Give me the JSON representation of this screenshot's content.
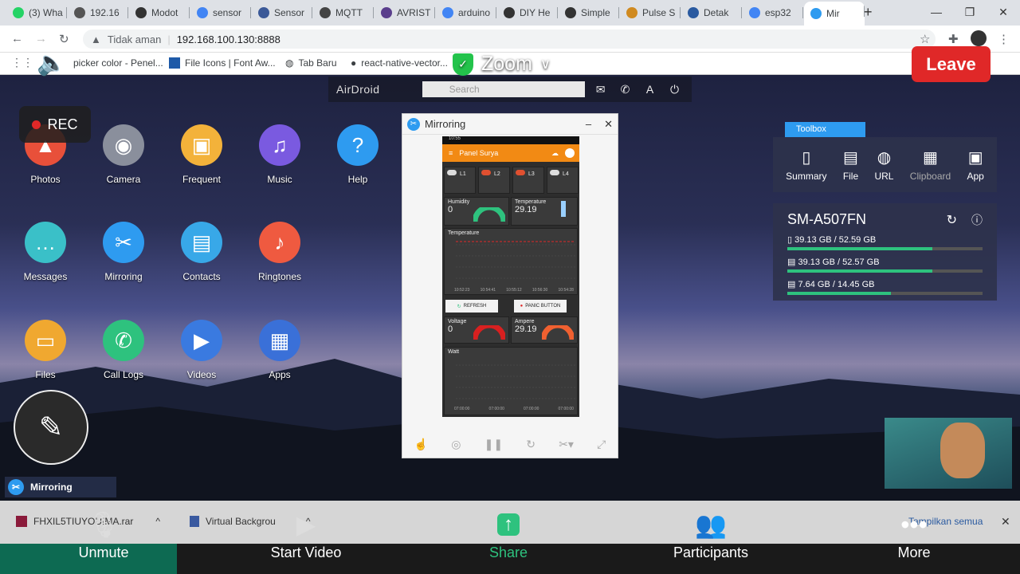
{
  "browser": {
    "tabs": [
      {
        "label": "(3) Wha",
        "color": "#25d366"
      },
      {
        "label": "192.16",
        "color": "#555"
      },
      {
        "label": "Modot",
        "color": "#333"
      },
      {
        "label": "sensor",
        "color": "#4285f4"
      },
      {
        "label": "Sensor",
        "color": "#3b5998"
      },
      {
        "label": "MQTT",
        "color": "#444"
      },
      {
        "label": "AVRIST",
        "color": "#5a3e8c"
      },
      {
        "label": "arduino",
        "color": "#4285f4"
      },
      {
        "label": "DIY He",
        "color": "#333"
      },
      {
        "label": "Simple",
        "color": "#333"
      },
      {
        "label": "Pulse S",
        "color": "#d08a20"
      },
      {
        "label": "Detak",
        "color": "#2a5aa0"
      },
      {
        "label": "esp32",
        "color": "#4285f4"
      },
      {
        "label": "Mir",
        "color": "#2e9bf0"
      }
    ],
    "security_label": "Tidak aman",
    "url": "192.168.100.130:8888",
    "bookmarks": [
      "picker color - Penel...",
      "File Icons | Font Aw...",
      "Tab Baru",
      "react-native-vector..."
    ]
  },
  "airdroid": {
    "logo": "AirDroid",
    "search_placeholder": "Search"
  },
  "desktop_icons": [
    {
      "label": "Photos",
      "color": "#e8503a",
      "glyph": "▲"
    },
    {
      "label": "Camera",
      "color": "#8a8f9c",
      "glyph": "◉"
    },
    {
      "label": "Frequent",
      "color": "#f3b23a",
      "glyph": "▣"
    },
    {
      "label": "Music",
      "color": "#7a5ae0",
      "glyph": "♫"
    },
    {
      "label": "Help",
      "color": "#2e9bf0",
      "glyph": "?"
    },
    {
      "label": "Messages",
      "color": "#3ac0c8",
      "glyph": "…"
    },
    {
      "label": "Mirroring",
      "color": "#2e9bf0",
      "glyph": "✂"
    },
    {
      "label": "Contacts",
      "color": "#38a8e8",
      "glyph": "▤"
    },
    {
      "label": "Ringtones",
      "color": "#ef5a40",
      "glyph": "♪"
    },
    {
      "label": "Files",
      "color": "#f0a830",
      "glyph": "▭"
    },
    {
      "label": "Call Logs",
      "color": "#2ec27e",
      "glyph": "✆"
    },
    {
      "label": "Videos",
      "color": "#3a7ae0",
      "glyph": "▶"
    },
    {
      "label": "Apps",
      "color": "#3a70d8",
      "glyph": "▦"
    }
  ],
  "zoom": {
    "rec": "REC",
    "title": "Zoom",
    "leave": "Leave",
    "mirroring_task": "Mirroring",
    "controls": {
      "unmute": "Unmute",
      "start_video": "Start Video",
      "share": "Share",
      "participants": "Participants",
      "more": "More"
    },
    "downloads": [
      "FHXIL5TIUYOUIMA.rar",
      "Virtual Backgrou"
    ],
    "show_all": "Tampilkan semua"
  },
  "mirror_window": {
    "title": "Mirroring",
    "phone": {
      "status": "10:55",
      "app_title": "Panel Surya",
      "switches": [
        "L1",
        "L2",
        "L3",
        "L4"
      ],
      "humidity": {
        "label": "Humidity",
        "value": "0"
      },
      "temperature": {
        "label": "Temperature",
        "value": "29.19"
      },
      "temp_chart": {
        "label": "Temperature",
        "x_ticks": [
          "10:52:23",
          "10:54:41",
          "10:55:12",
          "10:56:30",
          "10:54:28"
        ]
      },
      "refresh_label": "REFRESH",
      "panic_label": "PANIC BUTTON",
      "voltage": {
        "label": "Voltage",
        "value": "0"
      },
      "ampere": {
        "label": "Ampere",
        "value": "29.19"
      },
      "watt_chart": {
        "label": "Watt",
        "x_ticks": [
          "07:00:00",
          "07:00:00",
          "07:00:00",
          "07:00:00"
        ]
      }
    }
  },
  "toolbox": {
    "tab": "Toolbox",
    "items": [
      "Summary",
      "File",
      "URL",
      "Clipboard",
      "App"
    ]
  },
  "device": {
    "name": "SM-A507FN",
    "storage": [
      {
        "text": "39.13 GB / 52.59 GB",
        "fraction": 0.744
      },
      {
        "text": "39.13 GB / 52.57 GB",
        "fraction": 0.744
      },
      {
        "text": "7.64 GB / 14.45 GB",
        "fraction": 0.529
      }
    ]
  }
}
